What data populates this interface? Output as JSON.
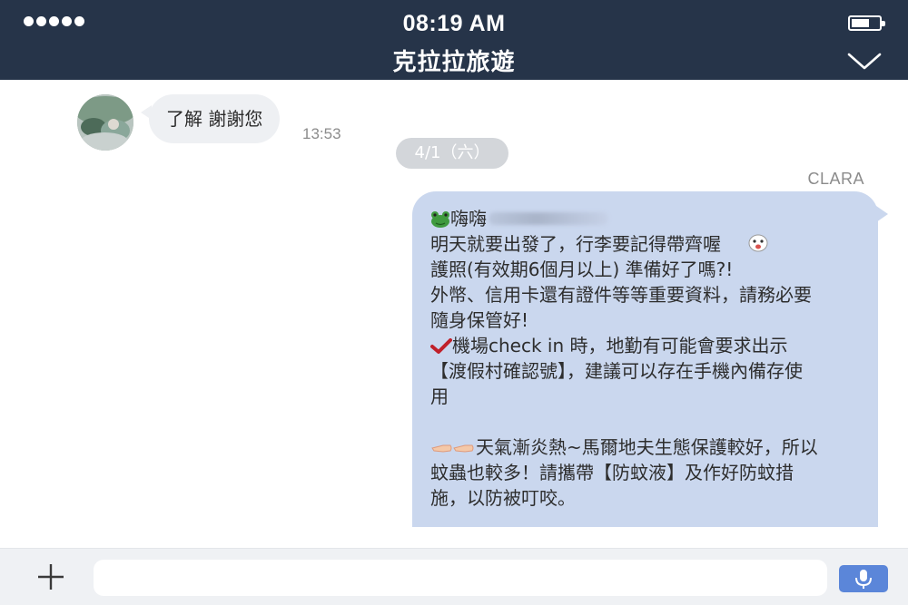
{
  "status_bar": {
    "signal_dots": 5,
    "time": "08:19 AM",
    "battery_icon": "battery-icon"
  },
  "header": {
    "title": "克拉拉旅遊",
    "dropdown_icon": "chevron-down-icon"
  },
  "messages": {
    "incoming": {
      "text": "了解 謝謝您",
      "time": "13:53",
      "avatar_icon": "avatar"
    },
    "date_divider": "4/1（六）",
    "outgoing": {
      "sender": "CLARA",
      "lines": [
        "嗨嗨",
        "明天就要出發了，行李要記得帶齊喔",
        "護照(有效期6個月以上) 準備好了嗎?!",
        "外幣、信用卡還有證件等等重要資料，請務必要",
        "隨身保管好!",
        "機場check in 時，地勤有可能會要求出示",
        "【渡假村確認號】，建議可以存在手機內備存使",
        "用",
        "",
        "天氣漸炎熱~馬爾地夫生態保護較好，所以",
        "蚊蟲也較多！請攜帶【防蚊液】及作好防蚊措",
        "施，以防被叮咬。"
      ]
    }
  },
  "input_bar": {
    "plus_icon": "plus-icon",
    "placeholder": "",
    "value": "",
    "mic_icon": "microphone-icon"
  },
  "colors": {
    "header_bg": "#263449",
    "outgoing_bubble": "#cad7ee",
    "incoming_bubble": "#eef0f3",
    "mic_button": "#5b86d9"
  }
}
